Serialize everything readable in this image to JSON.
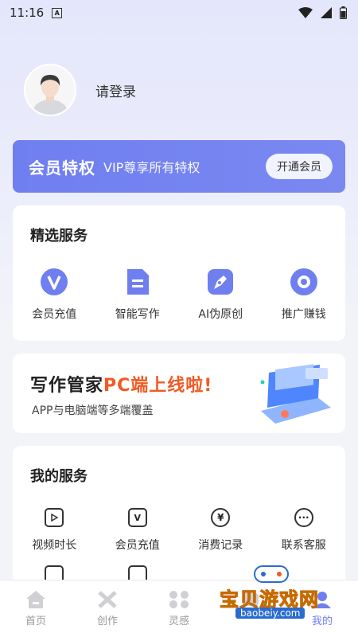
{
  "status_bar": {
    "time": "11:16",
    "a_badge": "A"
  },
  "profile": {
    "login_text": "请登录"
  },
  "vip_banner": {
    "title": "会员特权",
    "subtitle": "VIP尊享所有特权",
    "button_label": "开通会员"
  },
  "featured_services": {
    "title": "精选服务",
    "items": [
      {
        "label": "会员充值",
        "icon": "vip-v-icon"
      },
      {
        "label": "智能写作",
        "icon": "document-icon"
      },
      {
        "label": "AI伪原创",
        "icon": "pen-icon"
      },
      {
        "label": "推广赚钱",
        "icon": "coin-icon"
      }
    ]
  },
  "pc_banner": {
    "title_prefix": "写作管家",
    "title_highlight": "PC端上线啦!",
    "subtitle": "APP与电脑端等多端覆盖"
  },
  "my_services": {
    "title": "我的服务",
    "items": [
      {
        "label": "视频时长",
        "icon": "video-icon"
      },
      {
        "label": "会员充值",
        "icon": "vip-card-icon",
        "glyph": "V"
      },
      {
        "label": "消费记录",
        "icon": "yen-icon",
        "glyph": "¥"
      },
      {
        "label": "联系客服",
        "icon": "chat-icon",
        "glyph": "···"
      }
    ]
  },
  "tabbar": {
    "items": [
      {
        "label": "首页",
        "icon": "home-icon"
      },
      {
        "label": "创作",
        "icon": "create-icon"
      },
      {
        "label": "灵感",
        "icon": "inspiration-icon"
      },
      {
        "label": "",
        "icon": "hidden-tab-icon"
      },
      {
        "label": "我的",
        "icon": "profile-icon",
        "active": true
      }
    ]
  },
  "watermark": {
    "text": "宝贝游戏网",
    "url": "baobeiy.com"
  },
  "colors": {
    "accent": "#6f7ff0",
    "highlight": "#f05a24"
  }
}
